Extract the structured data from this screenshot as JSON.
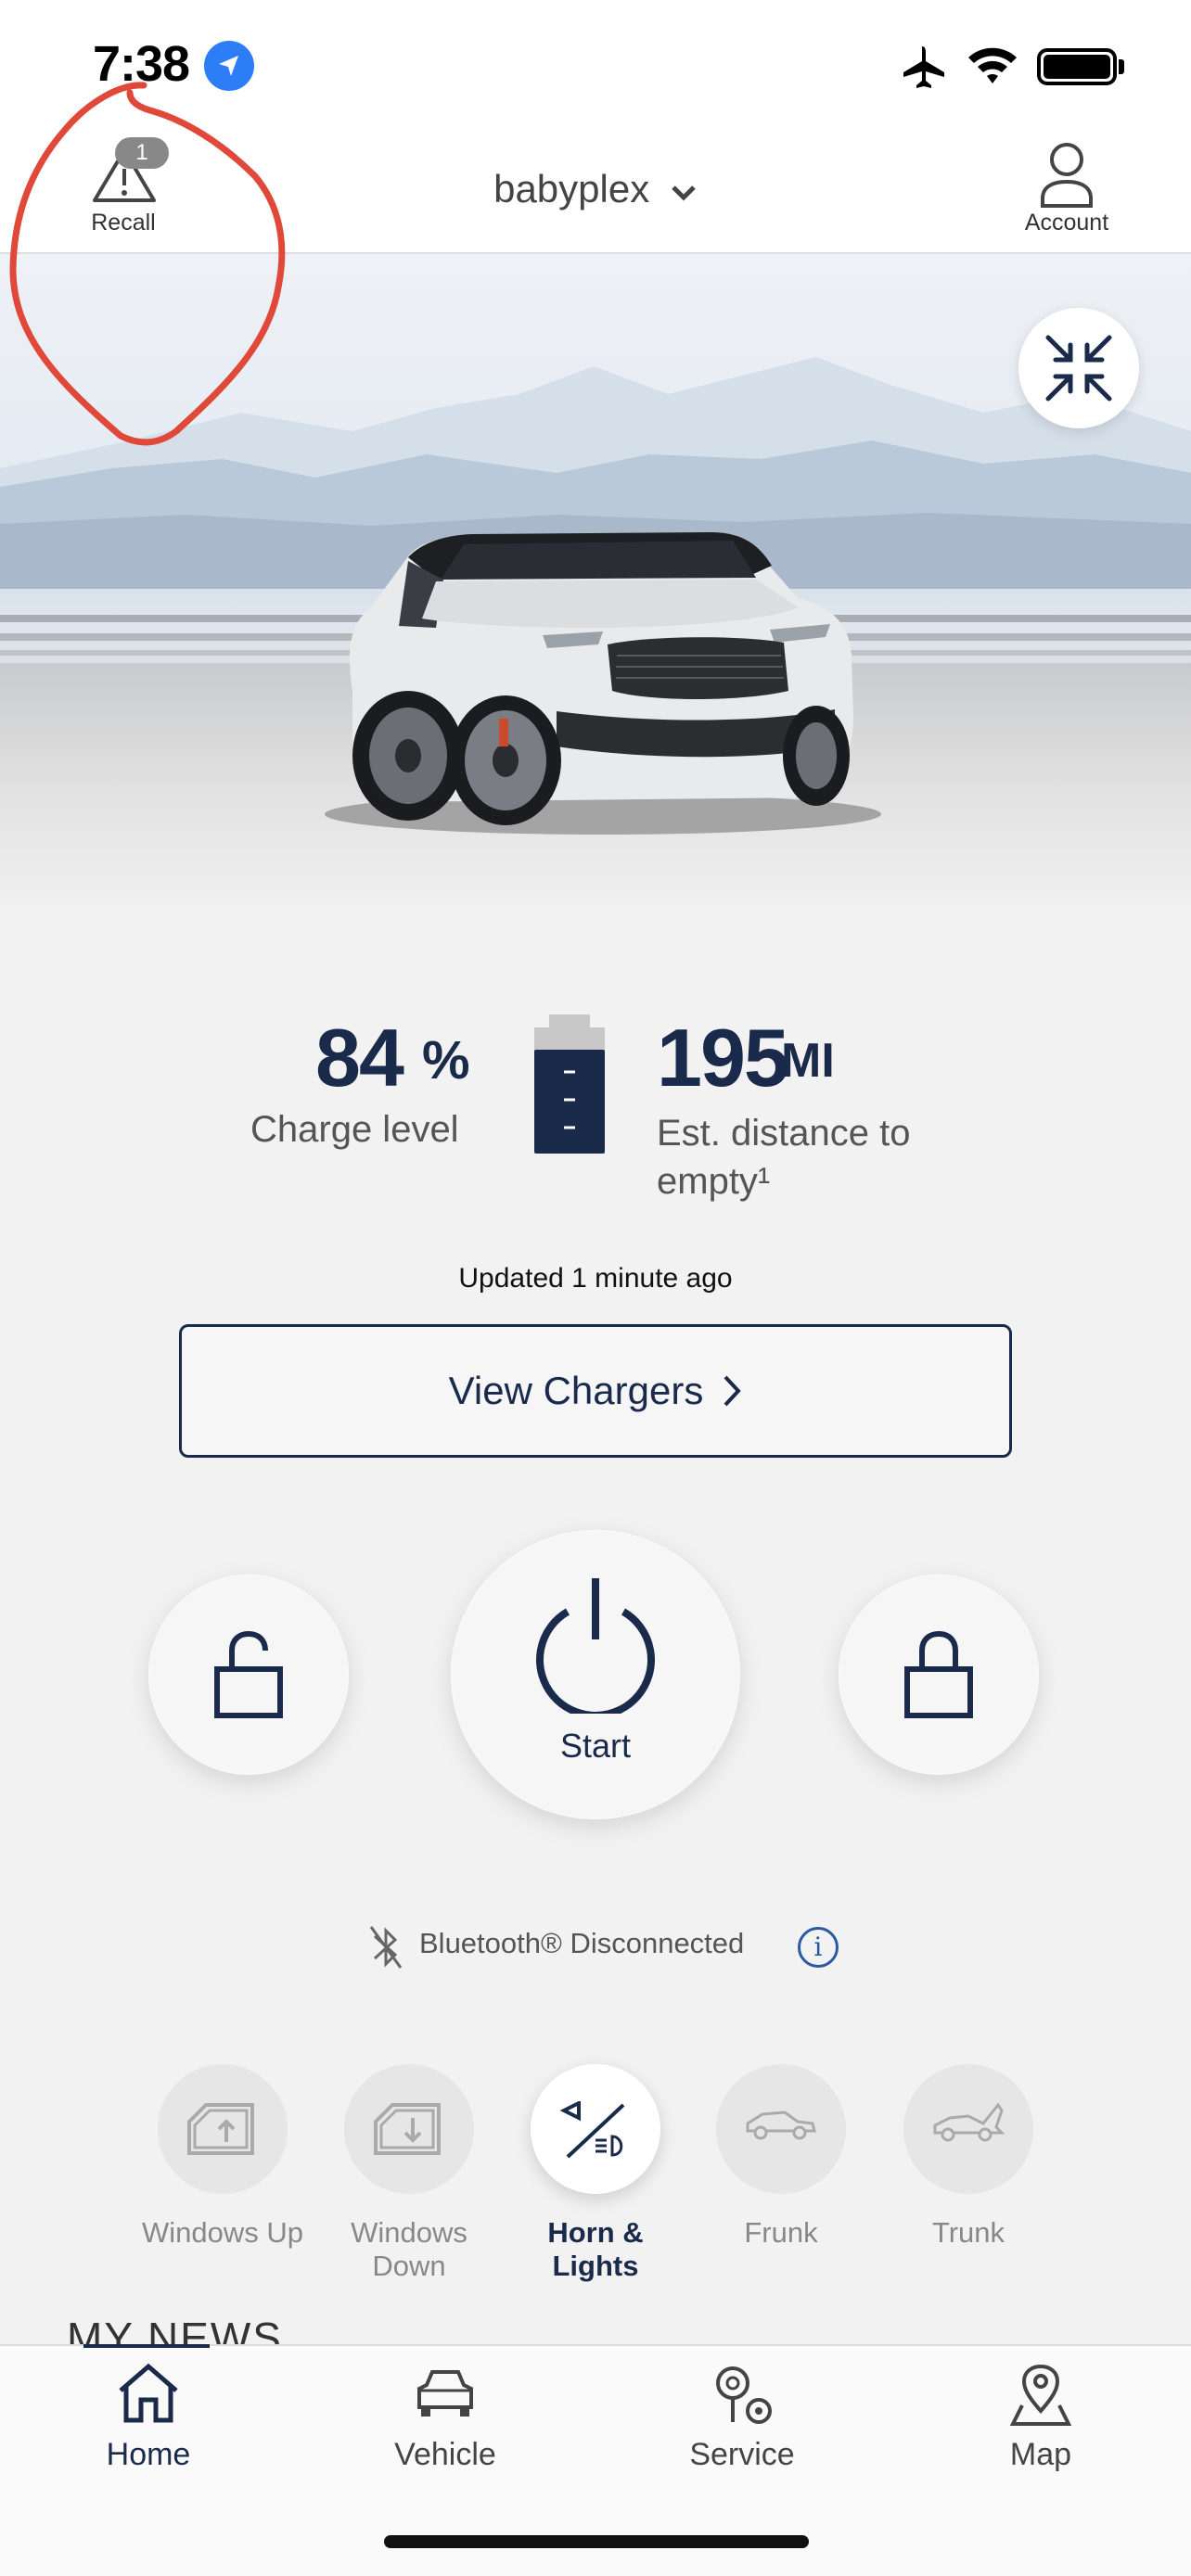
{
  "status_bar": {
    "time": "7:38"
  },
  "header": {
    "recall_label": "Recall",
    "recall_count": "1",
    "vehicle_name": "babyplex",
    "account_label": "Account"
  },
  "charge": {
    "value": "84",
    "unit": "%",
    "label": "Charge level",
    "range_value": "195",
    "range_unit": "MI",
    "range_label": "Est. distance to empty¹",
    "updated": "Updated 1 minute ago"
  },
  "view_chargers_label": "View Chargers",
  "remote": {
    "start_label": "Start"
  },
  "bluetooth_status": "Bluetooth® Disconnected",
  "quick_actions": [
    {
      "label": "Windows Up",
      "icon": "window-up-icon"
    },
    {
      "label": "Windows Down",
      "icon": "window-down-icon"
    },
    {
      "label": "Horn & Lights",
      "icon": "horn-lights-icon",
      "active": true
    },
    {
      "label": "Frunk",
      "icon": "frunk-icon"
    },
    {
      "label": "Trunk",
      "icon": "trunk-icon"
    }
  ],
  "news_heading": "MY NEWS",
  "bottom_nav": [
    {
      "label": "Home",
      "icon": "home-icon",
      "active": true
    },
    {
      "label": "Vehicle",
      "icon": "car-icon"
    },
    {
      "label": "Service",
      "icon": "service-icon"
    },
    {
      "label": "Map",
      "icon": "map-pin-icon"
    }
  ],
  "colors": {
    "navy": "#1a2a4a",
    "annotation": "#e0483a",
    "location_blue": "#2d7df6"
  }
}
